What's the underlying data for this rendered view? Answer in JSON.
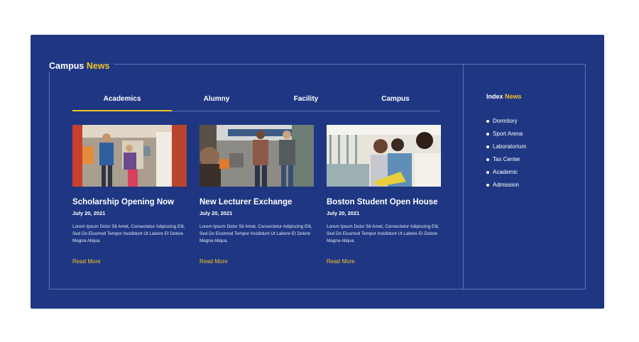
{
  "section": {
    "title_main": "Campus",
    "title_accent": "News"
  },
  "tabs": [
    {
      "label": "Academics",
      "active": true
    },
    {
      "label": "Alumny",
      "active": false
    },
    {
      "label": "Facility",
      "active": false
    },
    {
      "label": "Campus",
      "active": false
    }
  ],
  "cards": [
    {
      "title": "Scholarship Opening Now",
      "date": "July 20, 2021",
      "text": "Lorem Ipsum Dolor Sit Amet, Consectetur Adipiscing Elit, Sed Do Eiusmod Tempor Incididunt Ut Labore Et Dolore Magna Aliqua.",
      "link": "Read More"
    },
    {
      "title": "New Lecturer Exchange",
      "date": "July 20, 2021",
      "text": "Lorem Ipsum Dolor Sit Amet, Consectetur Adipiscing Elit, Sed Do Eiusmod Tempor Incididunt Ut Labore Et Dolore Magna Aliqua.",
      "link": "Read More"
    },
    {
      "title": "Boston Student Open House",
      "date": "July 20, 2021",
      "text": "Lorem Ipsum Dolor Sit Amet, Consectetur Adipiscing Elit, Sed Do Eiusmod Tempor Incididunt Ut Labore Et Dolore Magna Aliqua.",
      "link": "Read More"
    }
  ],
  "index": {
    "title_main": "Index",
    "title_accent": "News",
    "items": [
      "Dormitory",
      "Sport Arena",
      "Laboratorium",
      "Tax Center",
      "Academic",
      "Admission"
    ]
  },
  "colors": {
    "panel": "#1f3782",
    "accent": "#f2c229",
    "border": "#5d72b4",
    "text": "#ffffff"
  }
}
